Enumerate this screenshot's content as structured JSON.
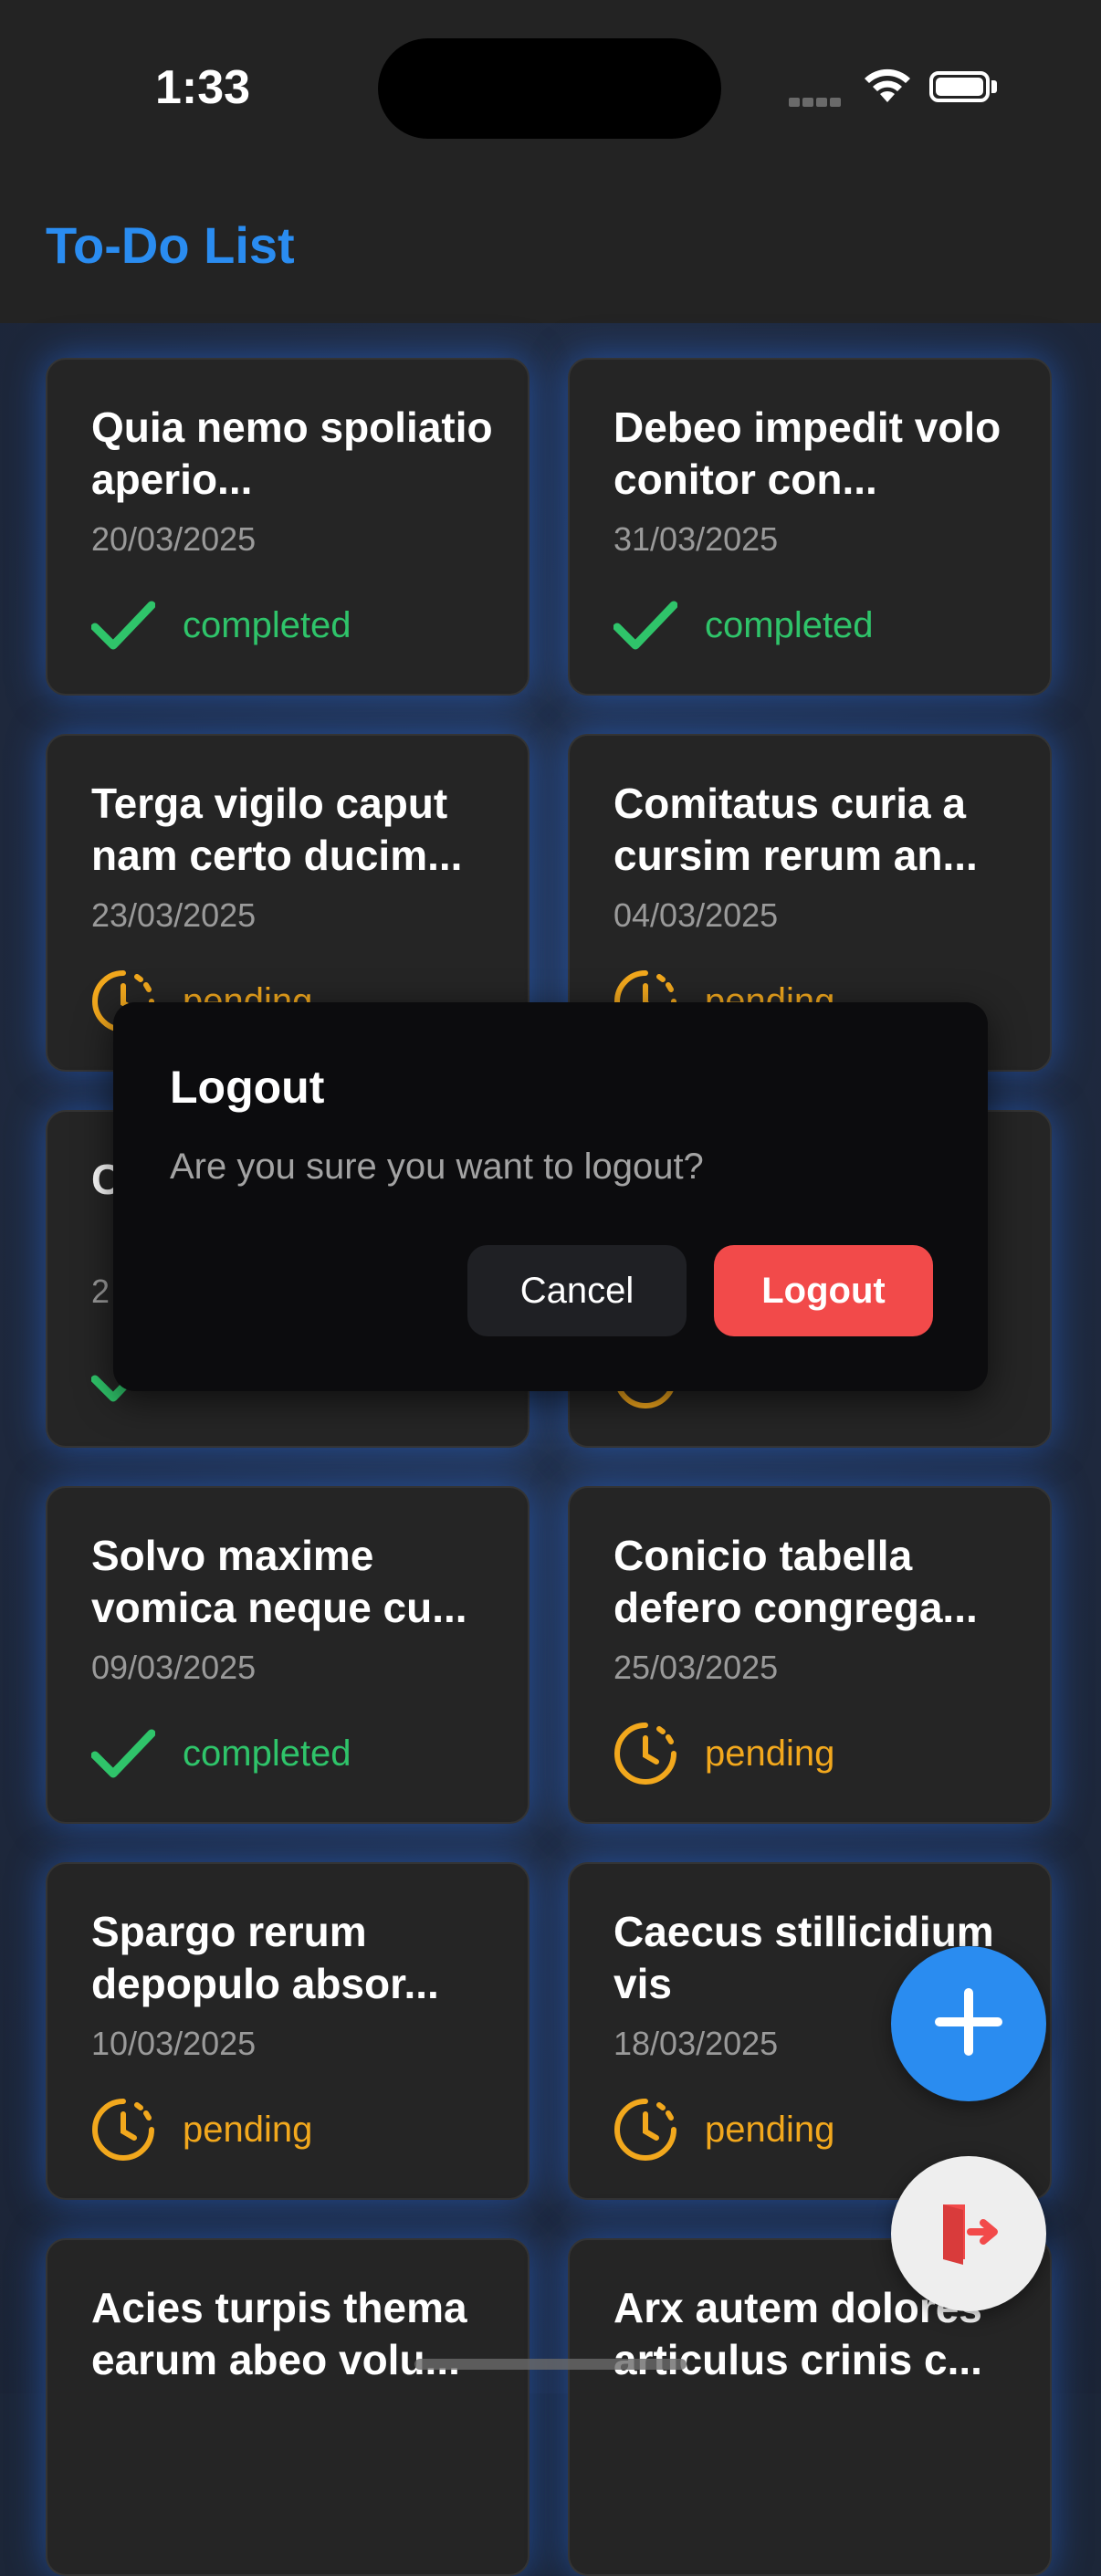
{
  "status_bar": {
    "time": "1:33"
  },
  "header": {
    "title": "To-Do List"
  },
  "tasks": [
    {
      "title": "Quia nemo spoliatio aperio...",
      "date": "20/03/2025",
      "status": "completed",
      "status_icon": "check-icon"
    },
    {
      "title": "Debeo impedit volo conitor con...",
      "date": "31/03/2025",
      "status": "completed",
      "status_icon": "check-icon"
    },
    {
      "title": "Terga vigilo caput nam certo ducim...",
      "date": "23/03/2025",
      "status": "pending",
      "status_icon": "clock-icon"
    },
    {
      "title": "Comitatus curia a cursim rerum an...",
      "date": "04/03/2025",
      "status": "pending",
      "status_icon": "clock-icon"
    },
    {
      "title": "C c",
      "date": "2",
      "status": "",
      "status_icon": "check-icon"
    },
    {
      "title": "",
      "date": "",
      "status": "",
      "status_icon": "clock-icon"
    },
    {
      "title": "Solvo maxime vomica neque cu...",
      "date": "09/03/2025",
      "status": "completed",
      "status_icon": "check-icon"
    },
    {
      "title": "Conicio tabella defero congrega...",
      "date": "25/03/2025",
      "status": "pending",
      "status_icon": "clock-icon"
    },
    {
      "title": "Spargo rerum depopulo absor...",
      "date": "10/03/2025",
      "status": "pending",
      "status_icon": "clock-icon"
    },
    {
      "title": "Caecus stillicidium vis",
      "date": "18/03/2025",
      "status": "pending",
      "status_icon": "clock-icon"
    },
    {
      "title": "Acies turpis thema earum abeo volu...",
      "date": "",
      "status": "",
      "status_icon": ""
    },
    {
      "title": "Arx autem dolores articulus crinis c...",
      "date": "",
      "status": "",
      "status_icon": ""
    }
  ],
  "dialog": {
    "title": "Logout",
    "message": "Are you sure you want to logout?",
    "cancel_label": "Cancel",
    "confirm_label": "Logout"
  },
  "fab": {
    "add_icon": "plus-icon",
    "logout_icon": "exit-door-icon"
  },
  "colors": {
    "accent": "#2a8cf0",
    "completed": "#2fc46a",
    "pending": "#f2a81d",
    "danger": "#f24a4a"
  }
}
